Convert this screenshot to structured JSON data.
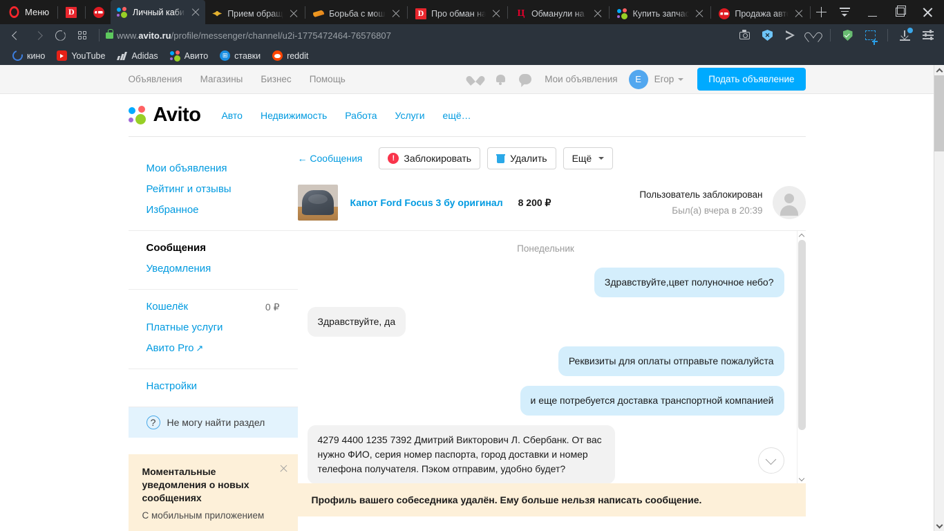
{
  "browser": {
    "menu_label": "Меню",
    "tabs": [
      {
        "title": "Личный кабине",
        "icon": "avito-icon",
        "active": true
      },
      {
        "title": "Прием обращен",
        "icon": "gosuslugi-icon",
        "active": false
      },
      {
        "title": "Борьба с мошен",
        "icon": "sberbank-icon",
        "active": false
      },
      {
        "title": "Про обман на A",
        "icon": "drom-d-icon",
        "active": false
      },
      {
        "title": "Обманули на ав",
        "icon": "tsian-icon",
        "active": false
      },
      {
        "title": "Купить запчасти",
        "icon": "avito-icon",
        "active": false
      },
      {
        "title": "Продажа автом",
        "icon": "drom-icon",
        "active": false
      }
    ],
    "url_prefix": "www.",
    "url_domain": "avito.ru",
    "url_path": "/profile/messenger/channel/u2i-1775472464-76576807",
    "bookmarks": [
      {
        "label": "кино",
        "icon": "kino-icon"
      },
      {
        "label": "YouTube",
        "icon": "youtube-icon"
      },
      {
        "label": "Adidas",
        "icon": "adidas-icon"
      },
      {
        "label": "Авито",
        "icon": "avito-icon"
      },
      {
        "label": "ставки",
        "icon": "stavki-icon"
      },
      {
        "label": "reddit",
        "icon": "reddit-icon"
      }
    ]
  },
  "topbar": {
    "links": [
      "Объявления",
      "Магазины",
      "Бизнес",
      "Помощь"
    ],
    "my_ads": "Мои объявления",
    "avatar_initial": "E",
    "user_name": "Егор",
    "post_button": "Подать объявление"
  },
  "header": {
    "logo_text": "Avito",
    "categories": [
      "Авто",
      "Недвижимость",
      "Работа",
      "Услуги",
      "ещё…"
    ]
  },
  "sidebar": {
    "group1": [
      "Мои объявления",
      "Рейтинг и отзывы",
      "Избранное"
    ],
    "group2": [
      "Сообщения",
      "Уведомления"
    ],
    "wallet_label": "Кошелёк",
    "wallet_balance": "0 ₽",
    "paid_services": "Платные услуги",
    "avito_pro": "Авито Pro",
    "avito_pro_arrow": "↗",
    "settings": "Настройки",
    "help_label": "Не могу найти раздел",
    "help_icon_glyph": "?",
    "promo": {
      "title": "Моментальные уведомления о новых сообщениях",
      "subtitle": "С мобильным приложением"
    }
  },
  "messenger": {
    "back_link": "← Сообщения",
    "block_button": "Заблокировать",
    "delete_button": "Удалить",
    "more_button": "Ещё",
    "item": {
      "title": "Капот Ford Focus 3 бу оригинал",
      "price": "8 200 ₽",
      "status": "Пользователь заблокирован",
      "last_seen": "Был(а) вчера в 20:39"
    },
    "day_separator": "Понедельник",
    "messages": [
      {
        "dir": "out",
        "text": "Здравствуйте,цвет полуночное небо?"
      },
      {
        "dir": "in",
        "text": "Здравствуйте, да"
      },
      {
        "dir": "out",
        "text": "Реквизиты для оплаты отправьте пожалуйста"
      },
      {
        "dir": "out",
        "text": "и еще потребуется доставка транспортной компанией"
      },
      {
        "dir": "in",
        "text": "4279 4400 1235 7392 Дмитрий Викторович Л. Сбербанк. От вас нужно ФИО, серия номер паспорта, город доставки и номер телефона получателя. Пэком отправим, удобно будет?"
      }
    ],
    "deleted_note": "Профиль вашего собеседника удалён. Ему больше нельзя написать сообщение."
  },
  "colors": {
    "accent": "#00aaff",
    "link": "#009ae0",
    "bubble_out": "#d4eefc",
    "bubble_in": "#f2f2f2",
    "warning_bg": "#fdf0d9",
    "danger": "#f9344b"
  }
}
